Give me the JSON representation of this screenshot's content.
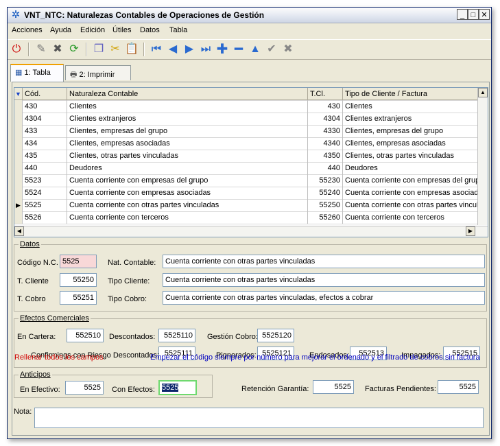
{
  "window": {
    "title": "VNT_NTC: Naturalezas Contables de Operaciones de Gestión"
  },
  "menu": [
    "Acciones",
    "Ayuda",
    "Edición",
    "Útiles",
    "Datos",
    "Tabla"
  ],
  "tabs": [
    {
      "label": "1: Tabla",
      "active": true
    },
    {
      "label": "2: Imprimir",
      "active": false
    }
  ],
  "grid": {
    "columns": [
      "Cód.",
      "Naturaleza Contable",
      "T.Cl.",
      "Tipo de Cliente / Factura"
    ],
    "rows": [
      {
        "cod": "430",
        "nat": "Clientes",
        "tcl": "430",
        "tipo": "Clientes"
      },
      {
        "cod": "4304",
        "nat": "Clientes extranjeros",
        "tcl": "4304",
        "tipo": "Clientes extranjeros"
      },
      {
        "cod": "433",
        "nat": "Clientes, empresas del grupo",
        "tcl": "4330",
        "tipo": "Clientes, empresas del grupo"
      },
      {
        "cod": "434",
        "nat": "Clientes, empresas asociadas",
        "tcl": "4340",
        "tipo": "Clientes, empresas asociadas"
      },
      {
        "cod": "435",
        "nat": "Clientes, otras partes vinculadas",
        "tcl": "4350",
        "tipo": "Clientes, otras partes vinculadas"
      },
      {
        "cod": "440",
        "nat": "Deudores",
        "tcl": "440",
        "tipo": "Deudores"
      },
      {
        "cod": "5523",
        "nat": "Cuenta corriente con empresas del grupo",
        "tcl": "55230",
        "tipo": "Cuenta corriente con empresas del grupo"
      },
      {
        "cod": "5524",
        "nat": "Cuenta corriente con empresas asociadas",
        "tcl": "55240",
        "tipo": "Cuenta corriente con empresas asociadas"
      },
      {
        "cod": "5525",
        "nat": "Cuenta corriente con otras partes vinculadas",
        "tcl": "55250",
        "tipo": "Cuenta corriente con otras partes vinculadas",
        "current": true
      },
      {
        "cod": "5526",
        "nat": "Cuenta corriente con terceros",
        "tcl": "55260",
        "tipo": "Cuenta corriente con terceros"
      }
    ]
  },
  "datos": {
    "legend": "Datos",
    "codigo_label": "Código N.C.",
    "codigo": "5525",
    "nat_label": "Nat. Contable:",
    "nat": "Cuenta corriente con otras partes vinculadas",
    "tcliente_label": "T. Cliente",
    "tcliente": "55250",
    "tipocliente_label": "Tipo Cliente:",
    "tipocliente": "Cuenta corriente con otras partes vinculadas",
    "tcobro_label": "T. Cobro",
    "tcobro": "55251",
    "tipocobro_label": "Tipo Cobro:",
    "tipocobro": "Cuenta corriente con otras partes vinculadas, efectos a cobrar"
  },
  "efectos": {
    "legend": "Efectos Comerciales",
    "en_cartera_label": "En Cartera:",
    "en_cartera": "552510",
    "descontados_label": "Descontados:",
    "descontados": "5525110",
    "gestion_label": "Gestión Cobro:",
    "gestion": "5525120",
    "confirmings_label": "Confirmings con Riesgo Descontados:",
    "confirmings": "5525111",
    "pignorados_label": "Pignorados:",
    "pignorados": "5525121",
    "endosados_label": "Endosados:",
    "endosados": "552513",
    "impagados_label": "Impagados:",
    "impagados": "552515"
  },
  "anticipos": {
    "legend": "Anticipos",
    "efectivo_label": "En Efectivo:",
    "efectivo": "5525",
    "con_efectos_label": "Con Efectos:",
    "con_efectos": "5525"
  },
  "otros": {
    "retencion_label": "Retención Garantía:",
    "retencion": "5525",
    "facturas_label": "Facturas Pendientes:",
    "facturas": "5525"
  },
  "nota": {
    "label": "Nota:",
    "value": ""
  },
  "footer": {
    "required": "Rellenar todos los campos",
    "hint": "Empezar el código siempre por número para mejorar el ordenado y el filtrado de cobros sin factura"
  }
}
